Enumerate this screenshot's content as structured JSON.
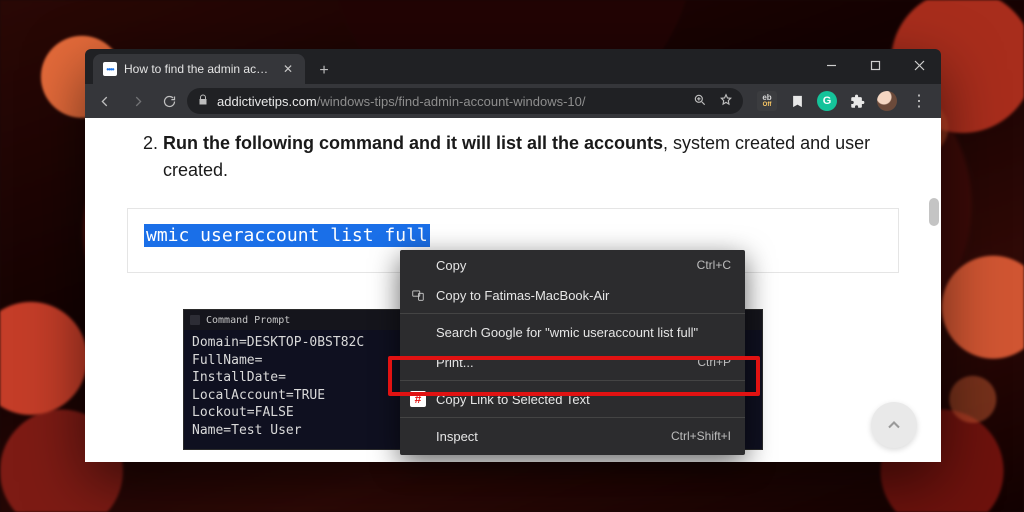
{
  "tab": {
    "title": "How to find the admin account o"
  },
  "url": {
    "host": "addictivetips.com",
    "path": "/windows-tips/find-admin-account-windows-10/"
  },
  "article": {
    "step_number": "2.",
    "step_bold": "Run the following command and it will list all the accounts",
    "step_rest": ", system created and user created.",
    "code_selected": "wmic useraccount list full"
  },
  "cmd": {
    "title": "Command Prompt",
    "lines": "Domain=DESKTOP-0BST82C\nFullName=\nInstallDate=\nLocalAccount=TRUE\nLockout=FALSE\nName=Test User"
  },
  "context_menu": {
    "copy": "Copy",
    "copy_shortcut": "Ctrl+C",
    "copy_to_device": "Copy to Fatimas-MacBook-Air",
    "search": "Search Google for \"wmic useraccount list full\"",
    "print": "Print...",
    "print_shortcut": "Ctrl+P",
    "copy_link": "Copy Link to Selected Text",
    "inspect": "Inspect",
    "inspect_shortcut": "Ctrl+Shift+I"
  },
  "ext": {
    "ebay_label": "eb",
    "ebay_sub": "Off",
    "grammarly": "G"
  }
}
